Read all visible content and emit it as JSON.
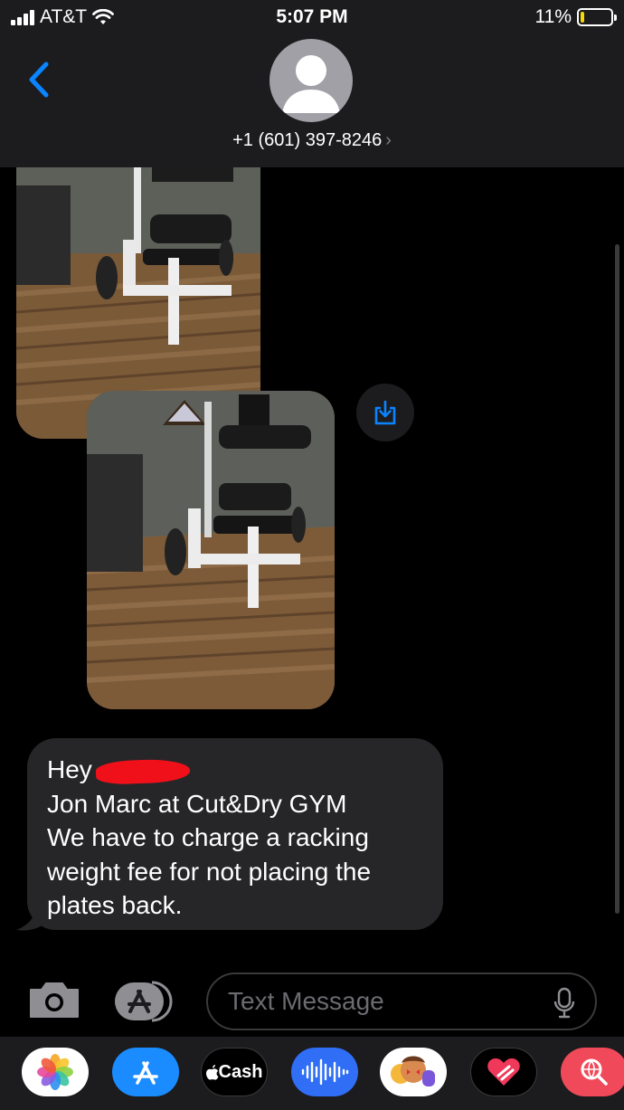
{
  "status_bar": {
    "carrier": "AT&T",
    "time": "5:07 PM",
    "battery_percent": "11%",
    "battery_level": 0.11
  },
  "header": {
    "contact": "+1 (601) 397-8246",
    "contact_chevron": "›"
  },
  "attachments": [
    {
      "icon": "photo-gym-machine"
    },
    {
      "icon": "photo-gym-machine"
    }
  ],
  "save_button": {
    "icon": "save-icon"
  },
  "message": {
    "greeting": "Hey",
    "lines": [
      "Jon Marc at Cut&Dry GYM",
      "We have to charge a racking",
      "weight fee for not placing the",
      "plates back."
    ]
  },
  "composer": {
    "placeholder": "Text Message"
  },
  "app_drawer": {
    "items": [
      {
        "icon": "photos-icon"
      },
      {
        "icon": "app-store-icon"
      },
      {
        "icon": "apple-cash-icon",
        "label": "Cash"
      },
      {
        "icon": "audio-message-icon"
      },
      {
        "icon": "memoji-icon"
      },
      {
        "icon": "digital-touch-icon"
      },
      {
        "icon": "images-search-icon"
      }
    ]
  },
  "colors": {
    "accent_blue": "#0a84ff",
    "bubble_gray": "#262628",
    "header_gray": "#1c1c1e",
    "battery_yellow": "#f5d90a"
  }
}
